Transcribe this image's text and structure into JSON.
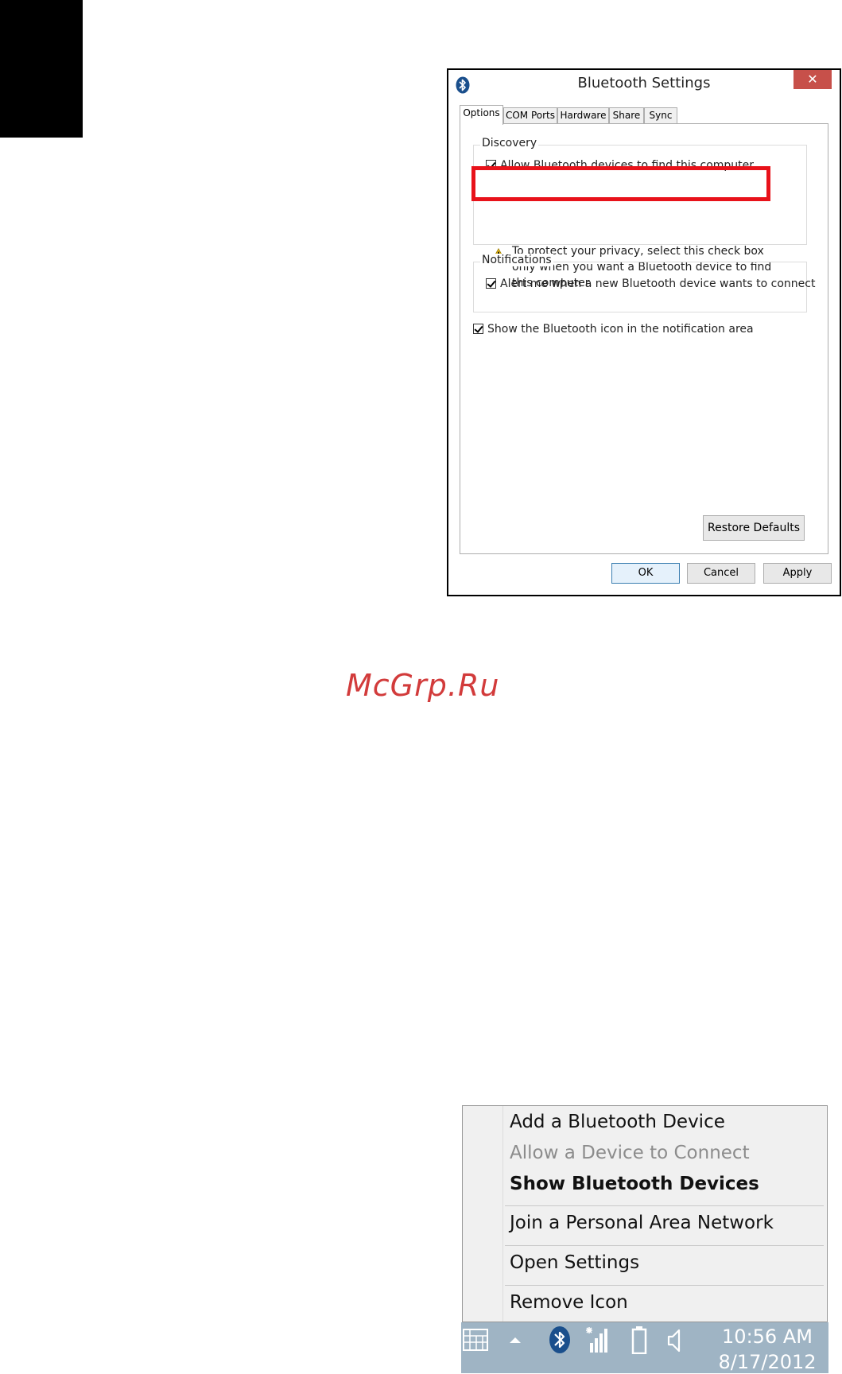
{
  "dialog": {
    "title": "Bluetooth Settings",
    "close_glyph": "✕",
    "tabs": [
      {
        "label": "Options"
      },
      {
        "label": "COM Ports"
      },
      {
        "label": "Hardware"
      },
      {
        "label": "Share"
      },
      {
        "label": "Sync"
      }
    ],
    "active_tab": "Options",
    "discovery": {
      "legend": "Discovery",
      "allow_label": "Allow Bluetooth devices to find this computer",
      "allow_checked": true,
      "privacy_text": "To protect your privacy, select this check box only when you want a Bluetooth device to find this computer."
    },
    "notifications": {
      "legend": "Notifications",
      "alert_label": "Alert me when a new Bluetooth device wants to connect",
      "alert_checked": true
    },
    "show_icon_label": "Show the Bluetooth icon in the notification area",
    "show_icon_checked": true,
    "restore_defaults": "Restore Defaults",
    "ok": "OK",
    "cancel": "Cancel",
    "apply": "Apply",
    "highlight_color": "#e8121a"
  },
  "watermark": "McGrp.Ru",
  "context_menu": {
    "items": [
      {
        "label": "Add a Bluetooth Device",
        "state": "normal"
      },
      {
        "label": "Allow a Device to Connect",
        "state": "disabled"
      },
      {
        "label": "Show Bluetooth Devices",
        "state": "bold"
      },
      {
        "label": "Join a Personal Area Network",
        "state": "normal"
      },
      {
        "label": "Open Settings",
        "state": "normal"
      },
      {
        "label": "Remove Icon",
        "state": "normal"
      }
    ]
  },
  "taskbar": {
    "time": "10:56 AM",
    "date": "8/17/2012",
    "icons": [
      "keyboard-icon",
      "chevron-up-icon",
      "bluetooth-icon",
      "network-signal-icon",
      "battery-icon",
      "speaker-icon"
    ]
  }
}
